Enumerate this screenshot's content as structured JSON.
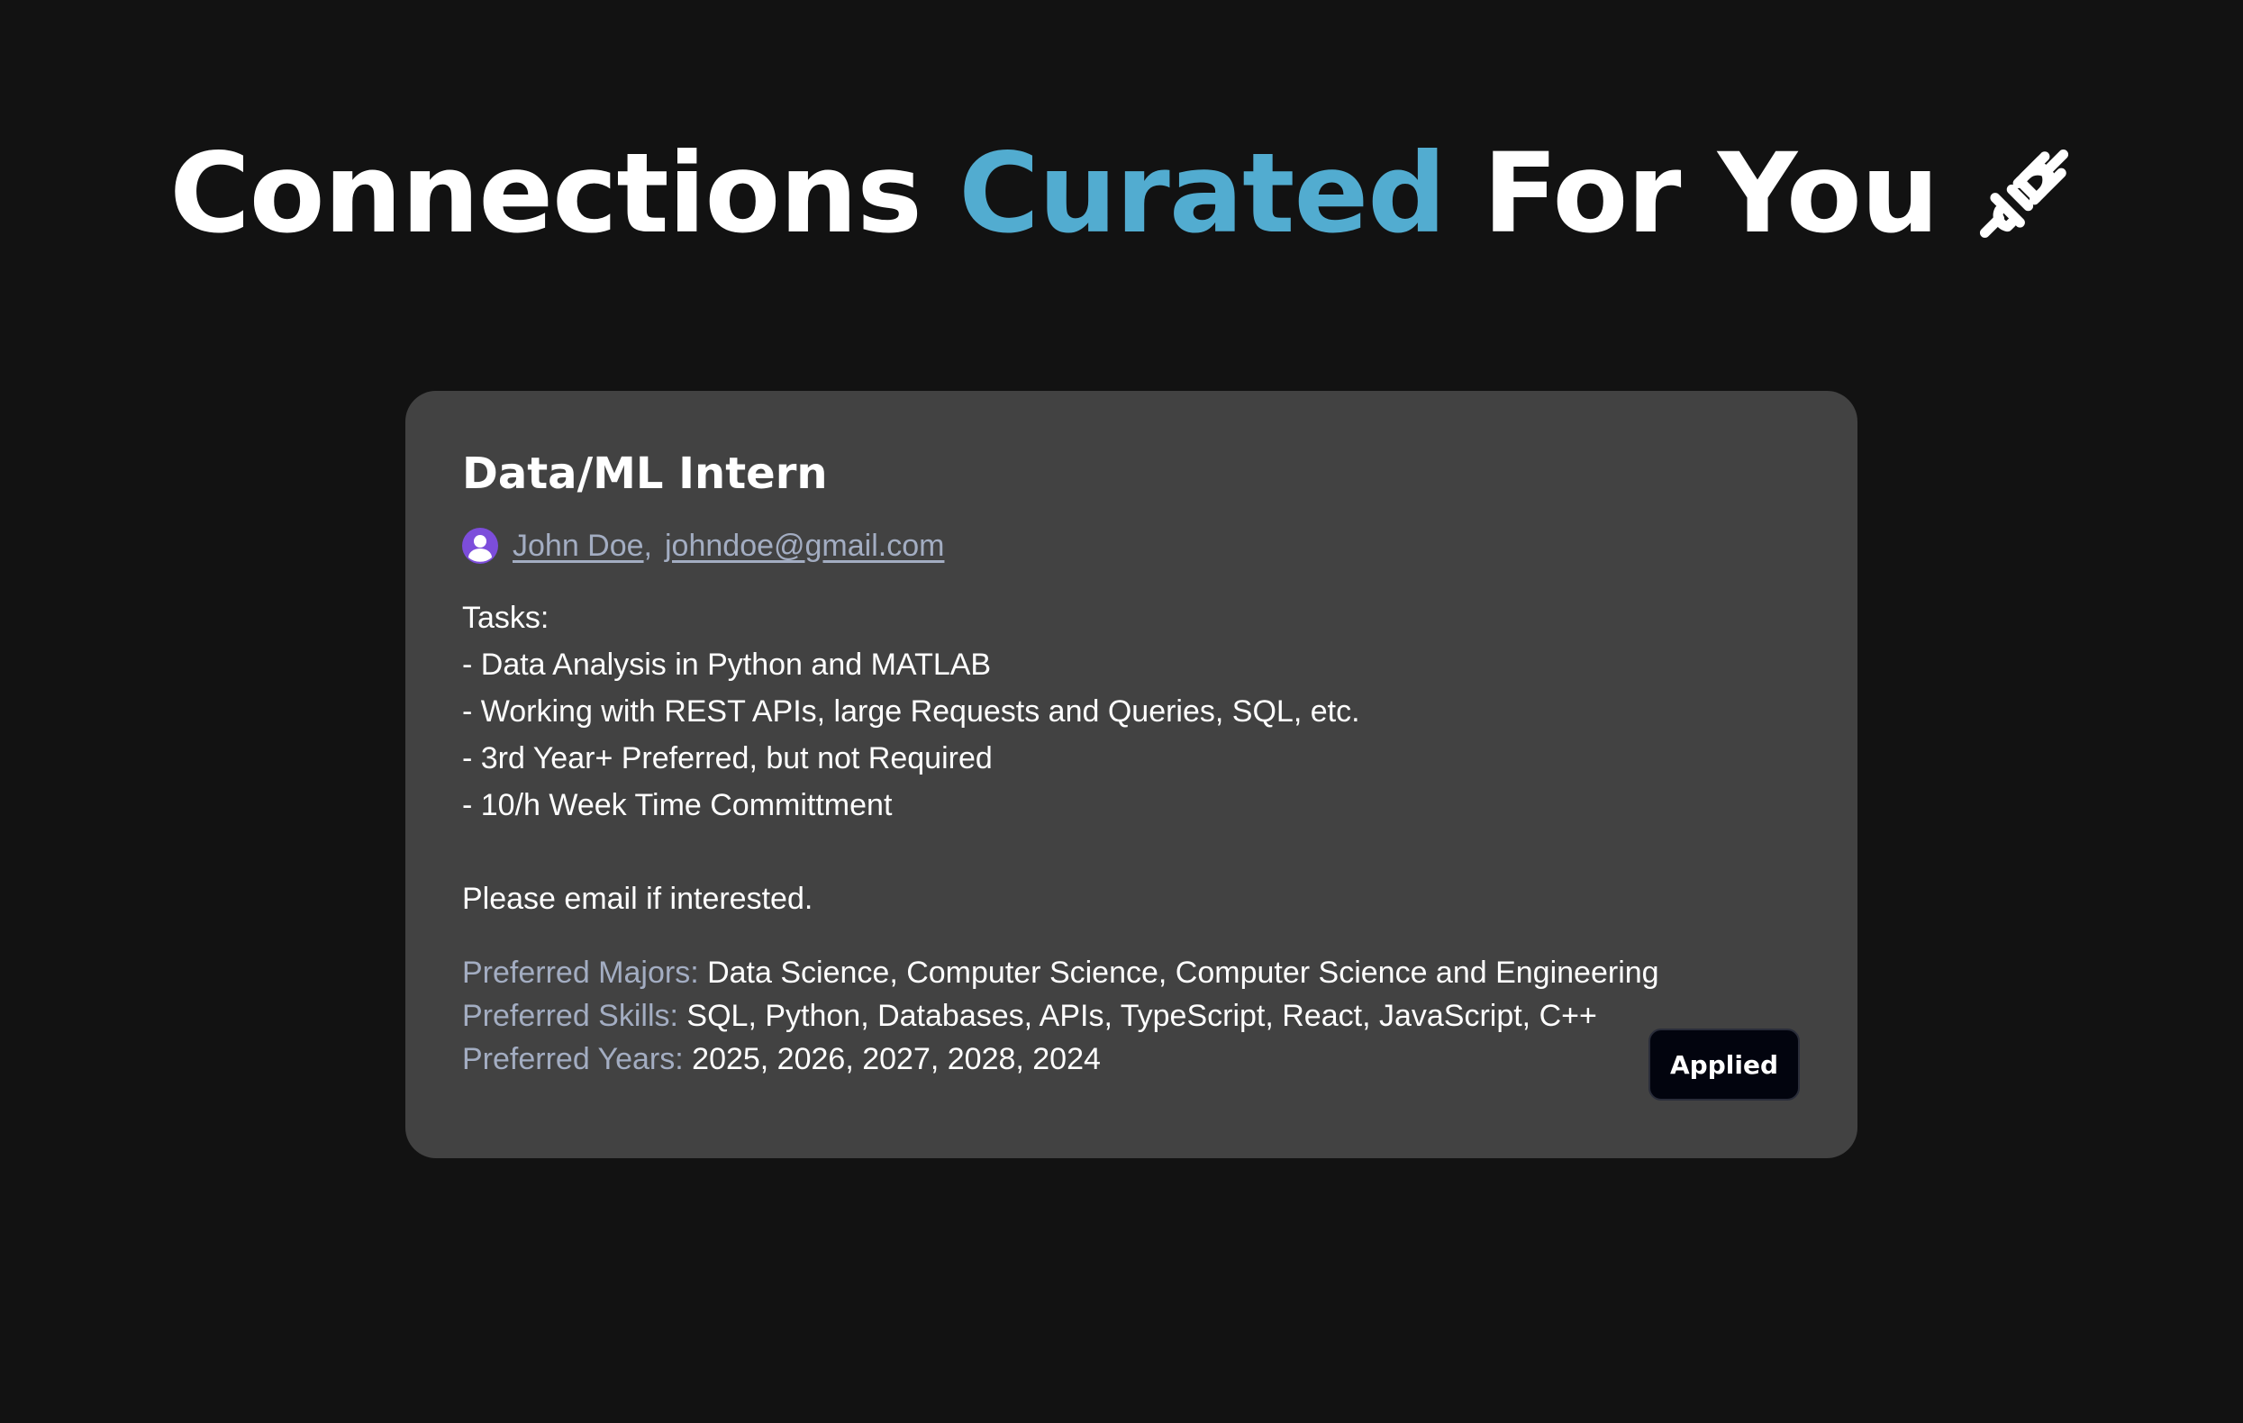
{
  "header": {
    "title_part1": "Connections",
    "title_accent": "Curated",
    "title_part2": "For You",
    "icon": "plug-icon",
    "accent_color": "#52acd0"
  },
  "card": {
    "title": "Data/ML Intern",
    "contact": {
      "icon": "user-avatar-icon",
      "name": "John Doe",
      "separator": ",",
      "email": "johndoe@gmail.com"
    },
    "description": "Tasks:\n- Data Analysis in Python and MATLAB\n- Working with REST APIs, large Requests and Queries, SQL, etc.\n- 3rd Year+ Preferred, but not Required\n- 10/h Week Time Committment\n\nPlease email if interested.",
    "preferences": {
      "majors_label": "Preferred Majors:",
      "majors_value": "Data Science, Computer Science, Computer Science and Engineering",
      "skills_label": "Preferred Skills:",
      "skills_value": "SQL, Python, Databases, APIs, TypeScript, React, JavaScript, C++",
      "years_label": "Preferred Years:",
      "years_value": "2025, 2026, 2027, 2028, 2024"
    },
    "status_button": "Applied"
  },
  "colors": {
    "background": "#121212",
    "card": "#424242",
    "muted_text": "#a3adc2",
    "button_bg": "#02040e",
    "avatar": "#7c4ddb"
  }
}
